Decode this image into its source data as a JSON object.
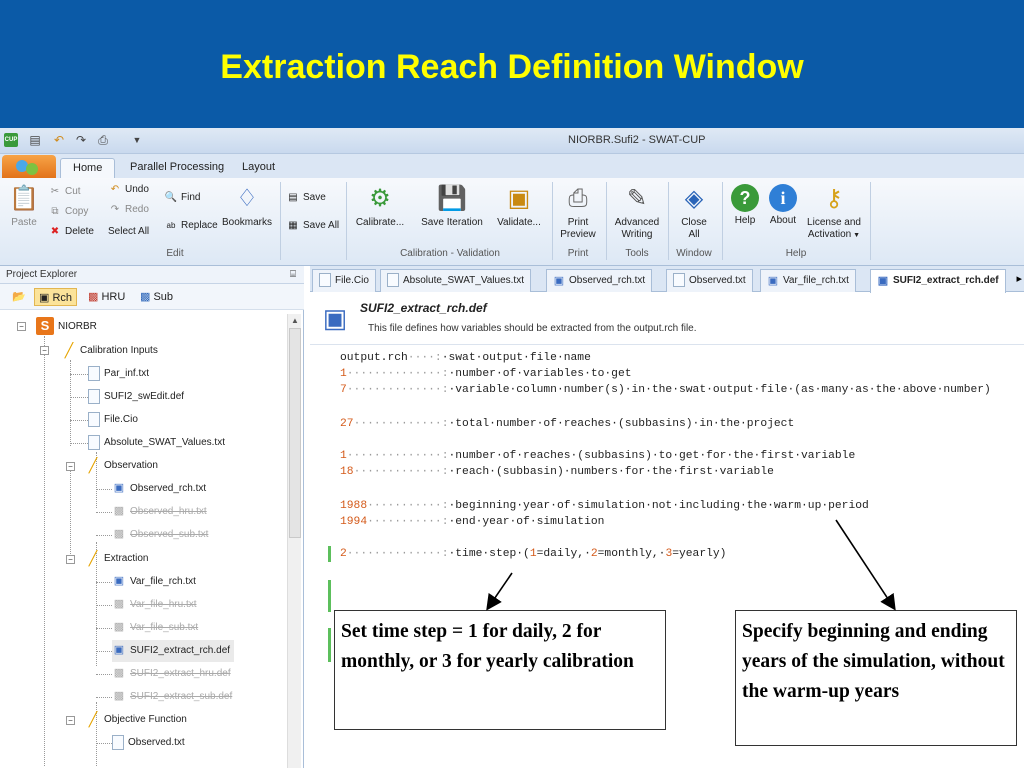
{
  "slide": {
    "title": "Extraction Reach Definition Window"
  },
  "window": {
    "title": "NIORBR.Sufi2 - SWAT-CUP",
    "logo": "CUP"
  },
  "ribbon_tabs": [
    "Home",
    "Parallel Processing",
    "Layout"
  ],
  "ribbon": {
    "edit": {
      "cut": "Cut",
      "copy": "Copy",
      "paste": "Paste",
      "delete": "Delete",
      "undo": "Undo",
      "redo": "Redo",
      "select_all": "Select All",
      "find": "Find",
      "replace": "Replace",
      "bookmarks": "Bookmarks",
      "label": "Edit"
    },
    "file": {
      "save": "Save",
      "save_all": "Save All"
    },
    "calibration": {
      "calibrate": "Calibrate...",
      "save_iteration": "Save Iteration",
      "validate": "Validate...",
      "label": "Calibration - Validation"
    },
    "print": {
      "print_preview_1": "Print",
      "print_preview_2": "Preview",
      "label": "Print"
    },
    "tools": {
      "advanced_writing_1": "Advanced",
      "advanced_writing_2": "Writing",
      "label": "Tools"
    },
    "window": {
      "close_all_1": "Close",
      "close_all_2": "All",
      "label": "Window"
    },
    "help": {
      "help": "Help",
      "about": "About",
      "license_1": "License and",
      "license_2": "Activation",
      "label": "Help"
    }
  },
  "explorer": {
    "title": "Project Explorer",
    "tools": {
      "rch": "Rch",
      "hru": "HRU",
      "sub": "Sub"
    },
    "tree": {
      "root": "NIORBR",
      "calibration_inputs": "Calibration Inputs",
      "par_inf": "Par_inf.txt",
      "swedit": "SUFI2_swEdit.def",
      "file_cio": "File.Cio",
      "abs_swat": "Absolute_SWAT_Values.txt",
      "observation": "Observation",
      "observed_rch": "Observed_rch.txt",
      "observed_hru": "Observed_hru.txt",
      "observed_sub": "Observed_sub.txt",
      "extraction": "Extraction",
      "var_file_rch": "Var_file_rch.txt",
      "var_file_hru": "Var_file_hru.txt",
      "var_file_sub": "Var_file_sub.txt",
      "extract_rch": "SUFI2_extract_rch.def",
      "extract_hru": "SUFI2_extract_hru.def",
      "extract_sub": "SUFI2_extract_sub.def",
      "objective_function": "Objective Function",
      "observed_txt": "Observed.txt"
    }
  },
  "doc_tabs": [
    "File.Cio",
    "Absolute_SWAT_Values.txt",
    "Observed_rch.txt",
    "Observed.txt",
    "Var_file_rch.txt",
    "SUFI2_extract_rch.def"
  ],
  "file_header": {
    "title": "SUFI2_extract_rch.def",
    "description": "This file defines how variables should be extracted from the output.rch file."
  },
  "code_lines": [
    {
      "value": "output.rch",
      "dots": "····:",
      "text": "·swat·output·file·name"
    },
    {
      "value": "1",
      "dots": "··············:",
      "text": "·number·of·variables·to·get"
    },
    {
      "value": "7",
      "dots": "··············:",
      "text": "·variable·column·number(s)·in·the·swat·output·file·(as·many·as·the·above·number)"
    },
    {
      "value": "27",
      "dots": "·············:",
      "text": "·total·number·of·reaches·(subbasins)·in·the·project"
    },
    {
      "value": "1",
      "dots": "··············:",
      "text": "·number·of·reaches·(subbasins)·to·get·for·the·first·variable"
    },
    {
      "value": "18",
      "dots": "·············:",
      "text": "·reach·(subbasin)·numbers·for·the·first·variable"
    },
    {
      "value": "1988",
      "dots": "···········:",
      "text": "·beginning·year·of·simulation·not·including·the·warm·up·period"
    },
    {
      "value": "1994",
      "dots": "···········:",
      "text": "·end·year·of·simulation"
    },
    {
      "value": "2",
      "dots": "··············:",
      "text": "·time·step·(",
      "opt1": "1",
      "t1": "=daily,·",
      "opt2": "2",
      "t2": "=monthly,·",
      "opt3": "3",
      "t3": "=yearly)"
    }
  ],
  "callouts": {
    "time_step": "Set time step = 1 for daily, 2 for monthly, or 3 for yearly calibration",
    "years": "Specify beginning and ending years of the simulation, without the warm-up years"
  }
}
